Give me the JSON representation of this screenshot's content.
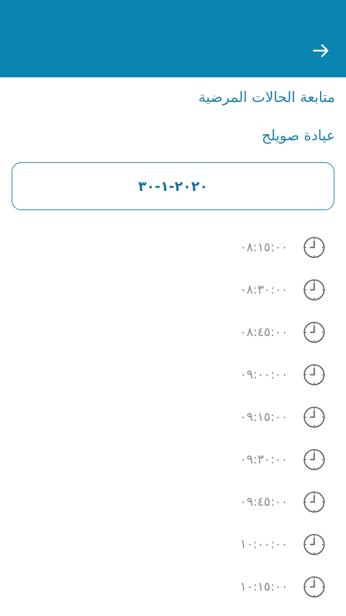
{
  "header": {
    "back_icon": "arrow-right-icon",
    "background_color": "#0a84b0"
  },
  "page": {
    "title": "متابعة الحالات المرضية",
    "clinic": "عيادة صويلح"
  },
  "date_selector": {
    "value": "٢٠٢٠-١-٣٠"
  },
  "time_slots": [
    {
      "time": "٠٨:١٥:٠٠",
      "icon": "clock-icon"
    },
    {
      "time": "٠٨:٣٠:٠٠",
      "icon": "clock-icon"
    },
    {
      "time": "٠٨:٤٥:٠٠",
      "icon": "clock-icon"
    },
    {
      "time": "٠٩:٠٠:٠٠",
      "icon": "clock-icon"
    },
    {
      "time": "٠٩:١٥:٠٠",
      "icon": "clock-icon"
    },
    {
      "time": "٠٩:٣٠:٠٠",
      "icon": "clock-icon"
    },
    {
      "time": "٠٩:٤٥:٠٠",
      "icon": "clock-icon"
    },
    {
      "time": "١٠:٠٠:٠٠",
      "icon": "clock-icon"
    },
    {
      "time": "١٠:١٥:٠٠",
      "icon": "clock-icon"
    }
  ]
}
